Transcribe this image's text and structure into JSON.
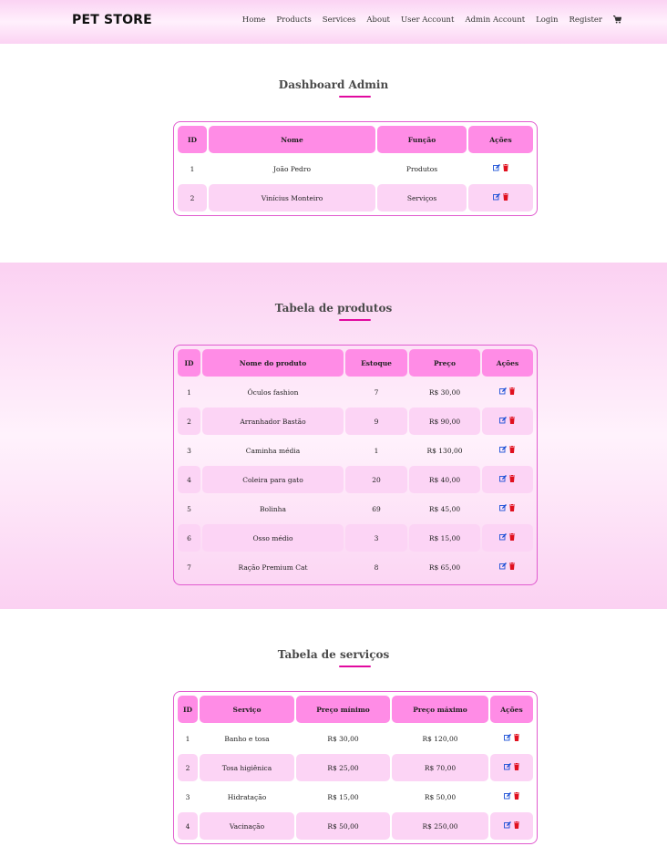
{
  "header": {
    "brand": "PET STORE",
    "nav": [
      "Home",
      "Products",
      "Services",
      "About",
      "User Account",
      "Admin Account",
      "Login",
      "Register"
    ]
  },
  "admin": {
    "title": "Dashboard Admin",
    "headers": [
      "ID",
      "Nome",
      "Função",
      "Ações"
    ],
    "rows": [
      [
        "1",
        "João Pedro",
        "Produtos"
      ],
      [
        "2",
        "Vinícius Monteiro",
        "Serviços"
      ]
    ]
  },
  "products": {
    "title": "Tabela de produtos",
    "headers": [
      "ID",
      "Nome do produto",
      "Estoque",
      "Preço",
      "Ações"
    ],
    "rows": [
      [
        "1",
        "Óculos fashion",
        "7",
        "R$ 30,00"
      ],
      [
        "2",
        "Arranhador Bastão",
        "9",
        "R$ 90,00"
      ],
      [
        "3",
        "Caminha média",
        "1",
        "R$ 130,00"
      ],
      [
        "4",
        "Coleira para gato",
        "20",
        "R$ 40,00"
      ],
      [
        "5",
        "Bolinha",
        "69",
        "R$ 45,00"
      ],
      [
        "6",
        "Osso médio",
        "3",
        "R$ 15,00"
      ],
      [
        "7",
        "Ração Premium Cat",
        "8",
        "R$ 65,00"
      ]
    ]
  },
  "services": {
    "title": "Tabela de serviços",
    "headers": [
      "ID",
      "Serviço",
      "Preço mínimo",
      "Preço máximo",
      "Ações"
    ],
    "rows": [
      [
        "1",
        "Banho e tosa",
        "R$ 30,00",
        "R$ 120,00"
      ],
      [
        "2",
        "Tosa higiênica",
        "R$ 25,00",
        "R$ 70,00"
      ],
      [
        "3",
        "Hidratação",
        "R$ 15,00",
        "R$ 50,00"
      ],
      [
        "4",
        "Vacinação",
        "R$ 50,00",
        "R$ 250,00"
      ]
    ]
  },
  "colors": {
    "accent": "#e1099f",
    "header_cell": "#ff8ce6",
    "alt_row": "#fcd4f5",
    "edit_icon": "#1a4fd6",
    "delete_icon": "#e0101e"
  },
  "icons": {
    "cart": "cart-icon",
    "edit": "edit-icon",
    "delete": "trash-icon"
  }
}
